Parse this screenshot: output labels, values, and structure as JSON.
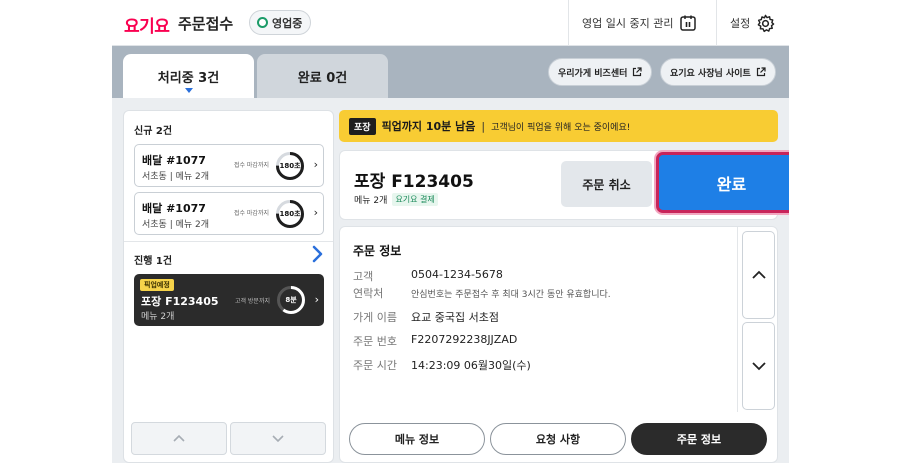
{
  "topbar": {
    "logo": "요기요",
    "app_title": "주문접수",
    "status_label": "영업중",
    "pause_label": "영업 일시 중지 관리",
    "settings_label": "설정"
  },
  "tabs": [
    {
      "label": "처리중 3건",
      "active": true
    },
    {
      "label": "완료 0건",
      "active": false
    }
  ],
  "links": {
    "biz_center": "우리가게 비즈센터",
    "owner_site": "요기요 사장님 사이트"
  },
  "order_list": {
    "new_section": "신규 2건",
    "new_orders": [
      {
        "title": "배달 #1077",
        "area": "서초동",
        "menu": "메뉴 2개",
        "deadline_label": "접수 마감까지",
        "timer": "180초",
        "timer_fraction": 0.75
      },
      {
        "title": "배달 #1077",
        "area": "서초동",
        "menu": "메뉴 2개",
        "deadline_label": "접수 마감까지",
        "timer": "180초",
        "timer_fraction": 0.75
      }
    ],
    "progress_section": "진행 1건",
    "progress_orders": [
      {
        "badge": "픽업예정",
        "title": "포장 F123405",
        "menu": "메뉴 2개",
        "label": "고객 방문까지",
        "timer": "8분",
        "timer_fraction": 0.6
      }
    ]
  },
  "banner": {
    "tag": "포장",
    "main": "픽업까지 10분 남음",
    "separator": "|",
    "message": "고객님이 픽업을 위해 오는 중이에요!"
  },
  "detail": {
    "title": "포장 F123405",
    "menu_count": "메뉴 2개",
    "payment": "요기요 결제",
    "cancel_label": "주문 취소",
    "done_label": "완료"
  },
  "order_info": {
    "section_title": "주문 정보",
    "contact_label_1": "고객",
    "contact_label_2": "연락처",
    "contact_value": "0504-1234-5678",
    "contact_note": "안심번호는 주문접수 후 최대 3시간 동안 유효합니다.",
    "store_label": "가게 이름",
    "store_value": "요교 중국집 서초점",
    "order_no_label": "주문 번호",
    "order_no_value": "F2207292238JJZAD",
    "order_time_label": "주문 시간",
    "order_time_value": "14:23:09  06월30일(수)"
  },
  "bottom_tabs": {
    "menu_info": "메뉴 정보",
    "request": "요청 사항",
    "order_info": "주문 정보"
  },
  "colors": {
    "brand": "#fa0050",
    "done_button": "#1e7fe6",
    "banner": "#f8cc33"
  }
}
